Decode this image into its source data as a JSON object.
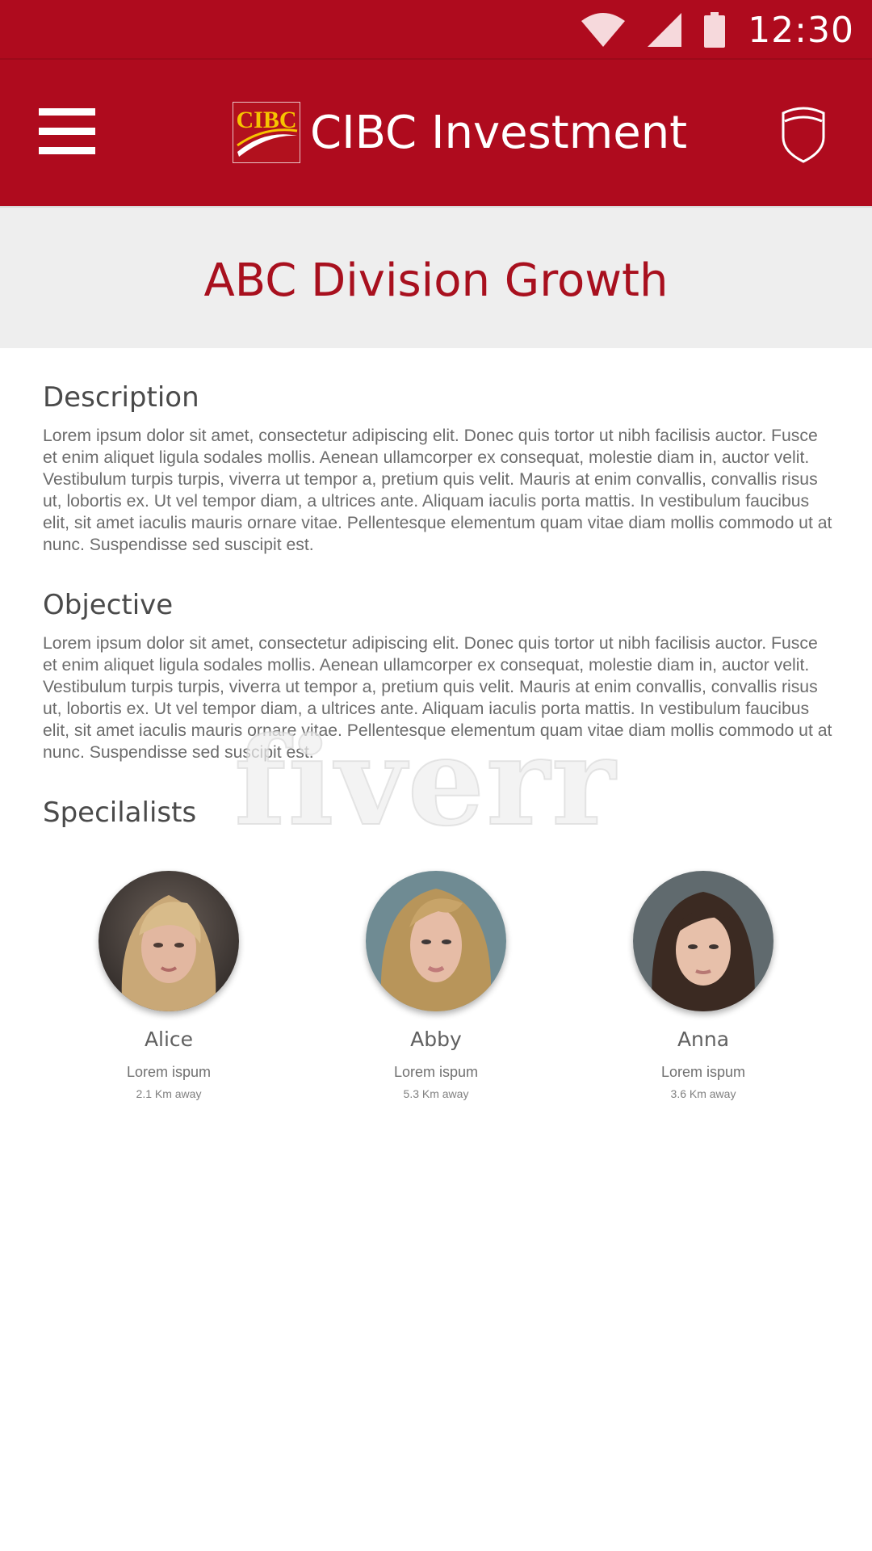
{
  "status_bar": {
    "time": "12:30",
    "icons": [
      "wifi-icon",
      "cellular-signal-icon",
      "battery-icon"
    ]
  },
  "app_bar": {
    "logo_text": "CIBC",
    "title": "CIBC Investment",
    "icons": [
      "menu-icon",
      "shield-icon"
    ]
  },
  "page": {
    "title": "ABC Division Growth"
  },
  "description": {
    "heading": "Description",
    "body": "Lorem ipsum dolor sit amet, consectetur adipiscing elit. Donec quis tortor ut nibh facilisis auctor. Fusce et enim aliquet ligula sodales mollis. Aenean ullamcorper ex consequat, molestie diam in, auctor velit. Vestibulum turpis turpis, viverra ut tempor a, pretium quis velit. Mauris at enim convallis, convallis risus ut, lobortis ex. Ut vel tempor diam, a ultrices ante. Aliquam iaculis porta mattis. In vestibulum faucibus elit, sit amet iaculis mauris ornare vitae. Pellentesque elementum quam vitae diam mollis commodo ut at nunc. Suspendisse sed suscipit est."
  },
  "objective": {
    "heading": "Objective",
    "body": "Lorem ipsum dolor sit amet, consectetur adipiscing elit. Donec quis tortor ut nibh facilisis auctor. Fusce et enim aliquet ligula sodales mollis. Aenean ullamcorper ex consequat, molestie diam in, auctor velit. Vestibulum turpis turpis, viverra ut tempor a, pretium quis velit. Mauris at enim convallis, convallis risus ut, lobortis ex. Ut vel tempor diam, a ultrices ante. Aliquam iaculis porta mattis. In vestibulum faucibus elit, sit amet iaculis mauris ornare vitae. Pellentesque elementum quam vitae diam mollis commodo ut at nunc. Suspendisse sed suscipit est."
  },
  "watermark": "fiverr",
  "specialists": {
    "heading": "Specilalists",
    "people": [
      {
        "name": "Alice",
        "role": "Lorem ispum",
        "distance": "2.1 Km away"
      },
      {
        "name": "Abby",
        "role": "Lorem ispum",
        "distance": "5.3 Km away"
      },
      {
        "name": "Anna",
        "role": "Lorem ispum",
        "distance": "3.6 Km away"
      }
    ]
  },
  "colors": {
    "brand_red": "#af0b1e",
    "title_red": "#a8101e",
    "title_band": "#eeeeee",
    "logo_gold": "#f6c400"
  }
}
